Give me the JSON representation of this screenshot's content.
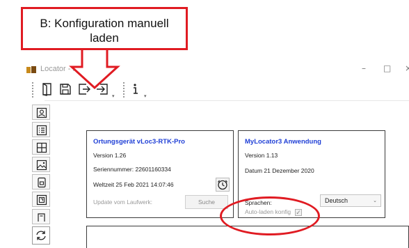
{
  "callout": {
    "text": "B: Konfiguration manuell laden",
    "line1": "B: Konfiguration manuell",
    "line2": "laden",
    "color": "#e01b22"
  },
  "window": {
    "title": "Locator - MyLocator3",
    "controls": {
      "minimize": "–",
      "maximize": "□",
      "close": "×"
    }
  },
  "toolbar": {
    "buttons": [
      "open-book-icon",
      "save-icon",
      "export-icon",
      "import-icon",
      "info-icon"
    ]
  },
  "sidebar": {
    "items": [
      "contact-icon",
      "list-icon",
      "grid-icon",
      "image-icon",
      "tablet-icon",
      "device-icon",
      "printer-icon",
      "refresh-icon"
    ]
  },
  "device_panel": {
    "title": "Ortungsgerät  vLoc3-RTK-Pro",
    "version": "Version 1.26",
    "serial": "Seriennummer:  22601160334",
    "worldtime": "Weltzeit 25 Feb 2021 14:07:46",
    "update_label": "Update vom Laufwerk:",
    "search_button": "Suche"
  },
  "app_panel": {
    "title": "MyLocator3 Anwendung",
    "version": "Version 1.13",
    "date": "Datum 21 Dezember 2020",
    "language_label": "Sprachen:",
    "language_value": "Deutsch",
    "autoload_label": "Auto-laden konfig",
    "autoload_checked": true
  },
  "colors": {
    "panel_title": "#1f3fd6",
    "annotation_red": "#e01b22"
  }
}
